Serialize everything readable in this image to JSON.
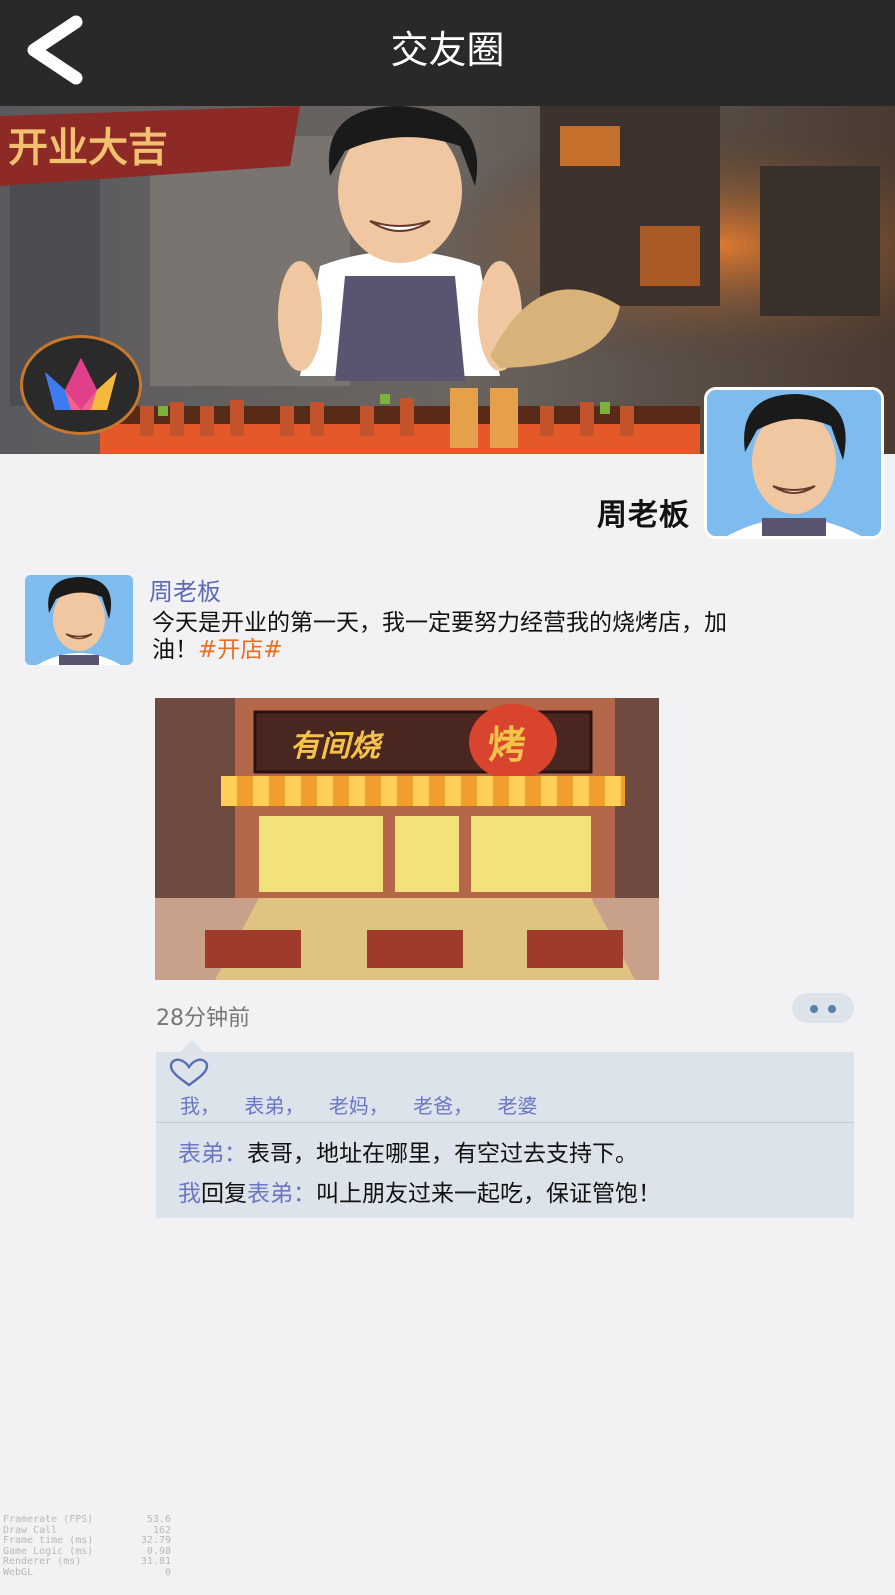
{
  "header": {
    "title": "交友圈",
    "back_icon": "chevron-left-icon"
  },
  "cover": {
    "banner_text": "开业大吉",
    "logo_icon": "crown-logo-icon"
  },
  "profile": {
    "name": "周老板"
  },
  "post": {
    "author": "周老板",
    "text": "今天是开业的第一天，我一定要努力经营我的烧烤店，加油！",
    "hashtag": "#开店#",
    "image_sign_1": "有间烧",
    "image_sign_2": "烤",
    "time": "28分钟前",
    "like_icon": "heart-icon",
    "likes": [
      "我，",
      "表弟，",
      "老妈，",
      "老爸，",
      "老婆"
    ],
    "comments": [
      {
        "user": "表弟",
        "sep": "：",
        "text": "表哥，地址在哪里，有空过去支持下。"
      },
      {
        "user": "我",
        "reply_word": "回复",
        "reply_to": "表弟",
        "sep": "：",
        "text": "叫上朋友过来一起吃，保证管饱！"
      }
    ]
  },
  "debug_stats": [
    {
      "label": "Framerate (FPS)",
      "value": "53.6"
    },
    {
      "label": "Draw Call",
      "value": "162"
    },
    {
      "label": "Frame time (ms)",
      "value": "32.79"
    },
    {
      "label": "Game Logic (ms)",
      "value": "0.98"
    },
    {
      "label": "Renderer (ms)",
      "value": "31.81"
    },
    {
      "label": "WebGL",
      "value": "0"
    }
  ],
  "colors": {
    "header_bg": "#2b2828",
    "link_purple": "#6a77c4",
    "hashtag_orange": "#ef6d1e",
    "comment_bg": "#dde3ea"
  }
}
